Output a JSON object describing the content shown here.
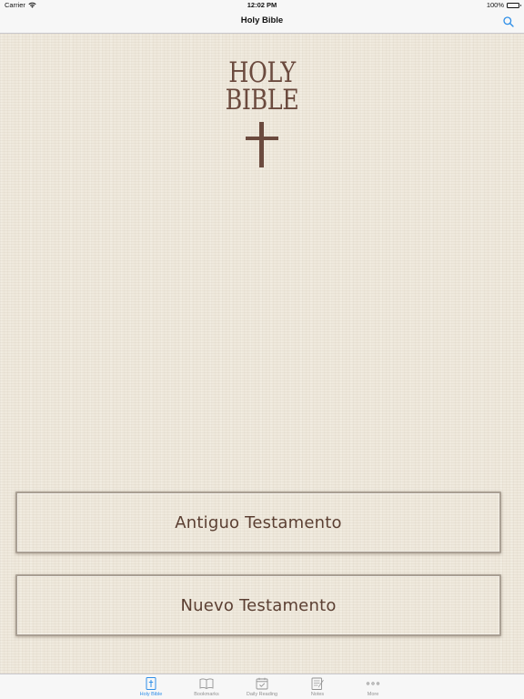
{
  "status_bar": {
    "carrier": "Carrier",
    "time": "12:02 PM",
    "battery": "100%"
  },
  "nav": {
    "title": "Holy Bible",
    "search_icon": "search-icon"
  },
  "logo": {
    "line1": "HOLY",
    "line2": "BIBLE"
  },
  "buttons": {
    "old_testament": "Antiguo Testamento",
    "new_testament": "Nuevo Testamento"
  },
  "tabs": [
    {
      "label": "Holy Bible",
      "icon": "bible-cross-icon",
      "active": true
    },
    {
      "label": "Bookmarks",
      "icon": "open-book-icon",
      "active": false
    },
    {
      "label": "Daily Reading",
      "icon": "calendar-check-icon",
      "active": false
    },
    {
      "label": "Notes",
      "icon": "notepad-pencil-icon",
      "active": false
    },
    {
      "label": "More",
      "icon": "more-dots-icon",
      "active": false
    }
  ],
  "colors": {
    "accent": "#2f8fe8",
    "brown": "#6b4a3e",
    "linen": "#efe9dd",
    "bar": "#f7f7f7"
  }
}
